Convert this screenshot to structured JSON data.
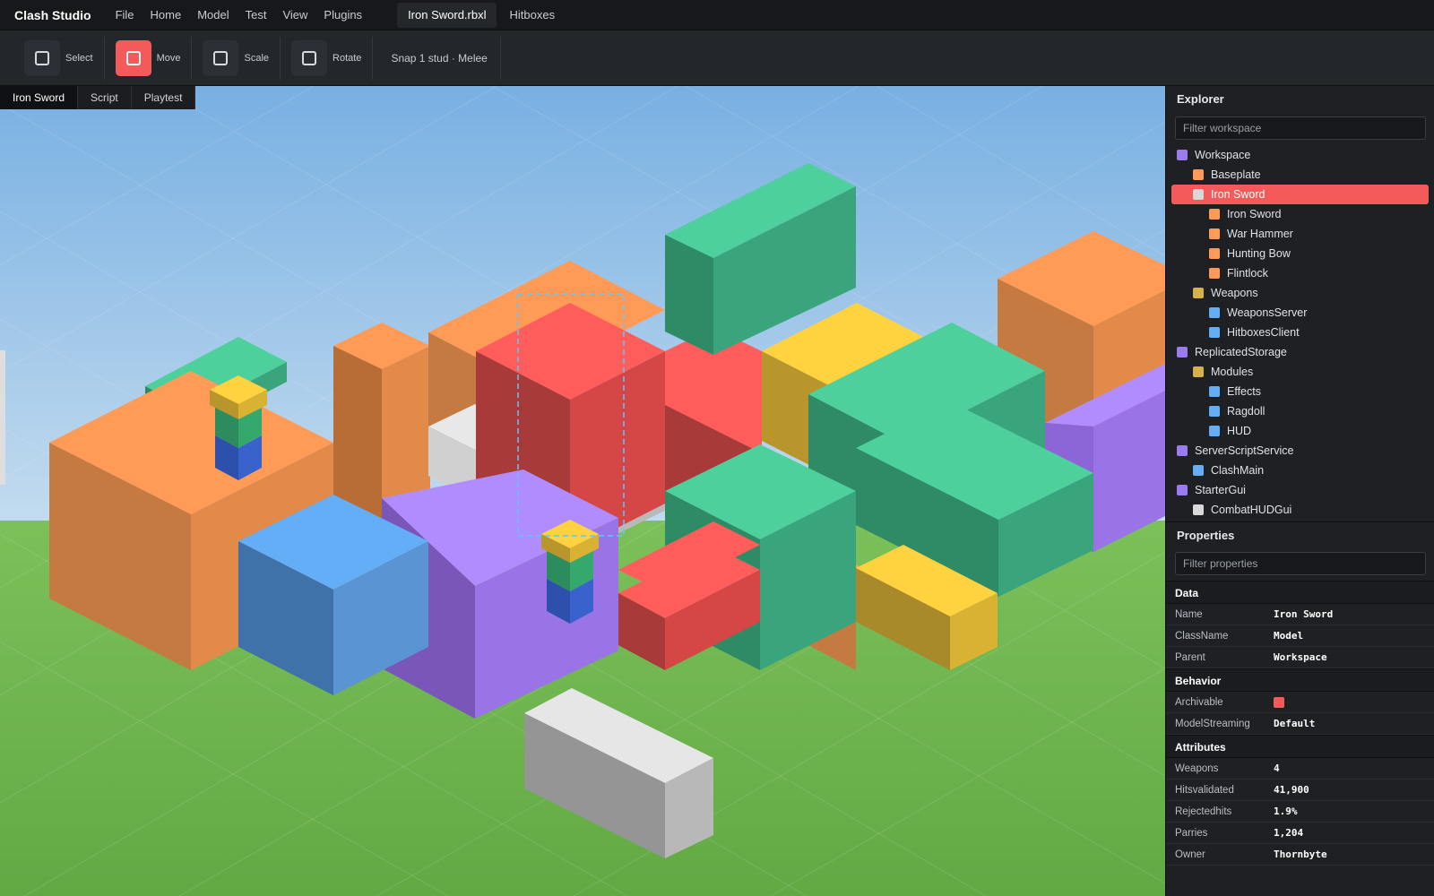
{
  "app": {
    "title": "Clash Studio",
    "menu": [
      "File",
      "Home",
      "Model",
      "Test",
      "View",
      "Plugins"
    ],
    "tabs": [
      {
        "label": "Iron Sword.rbxl",
        "active": true
      },
      {
        "label": "Hitboxes",
        "active": false
      }
    ]
  },
  "toolbar": {
    "tools": [
      {
        "label": "Select",
        "active": false,
        "icon": "select-icon"
      },
      {
        "label": "Move",
        "active": true,
        "icon": "move-icon"
      },
      {
        "label": "Scale",
        "active": false,
        "icon": "scale-icon"
      },
      {
        "label": "Rotate",
        "active": false,
        "icon": "rotate-icon"
      }
    ],
    "snap_label": "Snap 1 stud · Melee"
  },
  "viewport": {
    "tabs": [
      {
        "label": "Iron Sword",
        "active": true
      },
      {
        "label": "Script",
        "active": false
      },
      {
        "label": "Playtest",
        "active": false
      }
    ],
    "colors": {
      "sky_top": "#7eb3e0",
      "sky_bottom": "#c5dcee",
      "ground": "#6ab04c",
      "orange": "#ff9b57",
      "red": "#ff5c5c",
      "green": "#4dd09b",
      "yellow": "#ffd23f",
      "purple": "#b08cff",
      "blue": "#64aef8",
      "white": "#e6e6e6",
      "selection": "#5ec8ff"
    }
  },
  "explorer": {
    "title": "Explorer",
    "filter_placeholder": "Filter workspace",
    "items": [
      {
        "label": "Workspace",
        "depth": 0,
        "color": "#9b7cf0",
        "selected": false
      },
      {
        "label": "Baseplate",
        "depth": 1,
        "color": "#ff9b57",
        "selected": false
      },
      {
        "label": "Iron Sword",
        "depth": 1,
        "color": "#d8d8d8",
        "selected": true
      },
      {
        "label": "Iron Sword",
        "depth": 2,
        "color": "#ff9b57",
        "selected": false
      },
      {
        "label": "War Hammer",
        "depth": 2,
        "color": "#ff9b57",
        "selected": false
      },
      {
        "label": "Hunting Bow",
        "depth": 2,
        "color": "#ff9b57",
        "selected": false
      },
      {
        "label": "Flintlock",
        "depth": 2,
        "color": "#ff9b57",
        "selected": false
      },
      {
        "label": "Weapons",
        "depth": 1,
        "color": "#d8b04a",
        "selected": false
      },
      {
        "label": "WeaponsServer",
        "depth": 2,
        "color": "#64aef8",
        "selected": false
      },
      {
        "label": "HitboxesClient",
        "depth": 2,
        "color": "#64aef8",
        "selected": false
      },
      {
        "label": "ReplicatedStorage",
        "depth": 0,
        "color": "#9b7cf0",
        "selected": false
      },
      {
        "label": "Modules",
        "depth": 1,
        "color": "#d8b04a",
        "selected": false
      },
      {
        "label": "Effects",
        "depth": 2,
        "color": "#64aef8",
        "selected": false
      },
      {
        "label": "Ragdoll",
        "depth": 2,
        "color": "#64aef8",
        "selected": false
      },
      {
        "label": "HUD",
        "depth": 2,
        "color": "#64aef8",
        "selected": false
      },
      {
        "label": "ServerScriptService",
        "depth": 0,
        "color": "#9b7cf0",
        "selected": false
      },
      {
        "label": "ClashMain",
        "depth": 1,
        "color": "#64aef8",
        "selected": false
      },
      {
        "label": "StarterGui",
        "depth": 0,
        "color": "#9b7cf0",
        "selected": false
      },
      {
        "label": "CombatHUDGui",
        "depth": 1,
        "color": "#d8d8d8",
        "selected": false
      }
    ]
  },
  "properties": {
    "title": "Properties",
    "filter_placeholder": "Filter properties",
    "sections": [
      {
        "title": "Data",
        "rows": [
          {
            "key": "Name",
            "value": "Iron Sword"
          },
          {
            "key": "ClassName",
            "value": "Model"
          },
          {
            "key": "Parent",
            "value": "Workspace"
          }
        ]
      },
      {
        "title": "Behavior",
        "rows": [
          {
            "key": "Archivable",
            "value": "",
            "swatch": "#f55a5a"
          },
          {
            "key": "ModelStreaming",
            "value": "Default"
          }
        ]
      },
      {
        "title": "Attributes",
        "rows": [
          {
            "key": "Weapons",
            "value": "4"
          },
          {
            "key": "Hitsvalidated",
            "value": "41,900"
          },
          {
            "key": "Rejectedhits",
            "value": "1.9%"
          },
          {
            "key": "Parries",
            "value": "1,204"
          },
          {
            "key": "Owner",
            "value": "Thornbyte"
          }
        ]
      }
    ]
  }
}
